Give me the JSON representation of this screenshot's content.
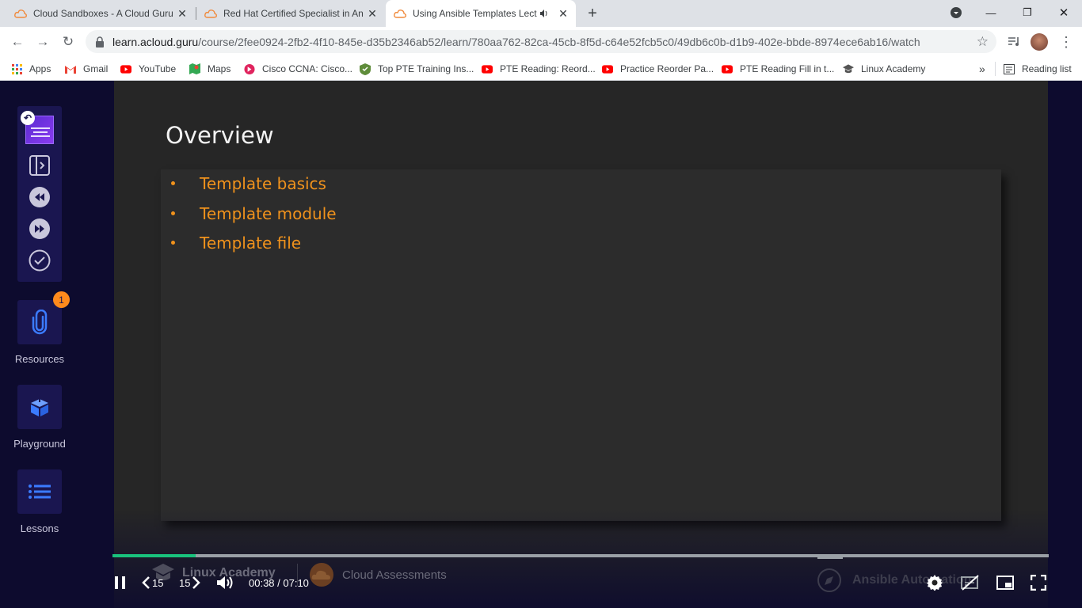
{
  "tabs": [
    {
      "title": "Cloud Sandboxes - A Cloud Guru",
      "active": false
    },
    {
      "title": "Red Hat Certified Specialist in An",
      "active": false
    },
    {
      "title": "Using Ansible Templates Lect",
      "active": true
    }
  ],
  "address_bar": {
    "domain": "learn.acloud.guru",
    "path": "/course/2fee0924-2fb2-4f10-845e-d35b2346ab52/learn/780aa762-82ca-45cb-8f5d-c64e52fcb5c0/49db6c0b-d1b9-402e-bbde-8974ece6ab16/watch"
  },
  "bookmarks": [
    {
      "label": "Apps",
      "icon": "apps-grid-icon",
      "color": "#ea4335"
    },
    {
      "label": "Gmail",
      "icon": "gmail-icon",
      "color": "#ea4335"
    },
    {
      "label": "YouTube",
      "icon": "youtube-icon",
      "color": "#ff0000"
    },
    {
      "label": "Maps",
      "icon": "maps-icon",
      "color": "#34a853"
    },
    {
      "label": "Cisco CCNA: Cisco...",
      "icon": "cisco-icon",
      "color": "#e0245e"
    },
    {
      "label": "Top PTE Training Ins...",
      "icon": "shield-icon",
      "color": "#5f8c3a"
    },
    {
      "label": "PTE Reading: Reord...",
      "icon": "youtube-icon",
      "color": "#ff0000"
    },
    {
      "label": "Practice Reorder Pa...",
      "icon": "youtube-icon",
      "color": "#ff0000"
    },
    {
      "label": "PTE Reading Fill in t...",
      "icon": "youtube-icon",
      "color": "#ff0000"
    },
    {
      "label": "Linux Academy",
      "icon": "graduation-cap-icon",
      "color": "#555"
    }
  ],
  "bookmarks_overflow": "»",
  "reading_list": "Reading list",
  "sidebar": {
    "resources_label": "Resources",
    "resources_badge": "1",
    "playground_label": "Playground",
    "lessons_label": "Lessons"
  },
  "slide": {
    "title": "Overview",
    "bullets": [
      "Template basics",
      "Template module",
      "Template file"
    ]
  },
  "player": {
    "skip_back": "15",
    "skip_forward": "15",
    "time": "00:38 / 07:10",
    "progress": 0.089
  },
  "watermarks": {
    "linux_academy": "Linux Academy",
    "cloud_assessments": "Cloud Assessments",
    "ansible": "Ansible Automation"
  },
  "colors": {
    "accent_orange": "#f0921c",
    "progress_green": "#19c37d",
    "sidebar_card": "#1a1650"
  }
}
